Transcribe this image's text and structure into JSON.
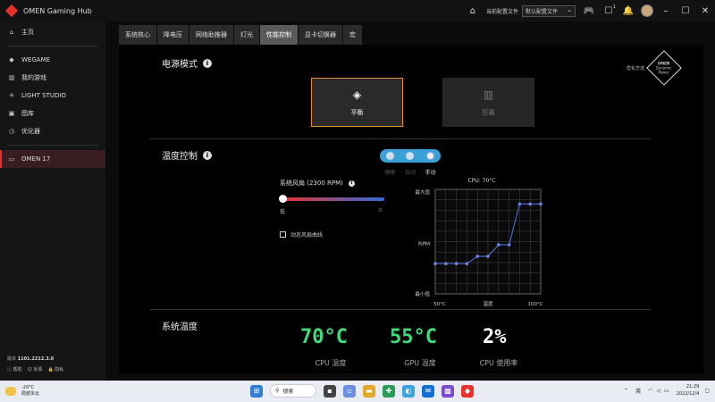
{
  "app": {
    "title": "OMEN Gaming Hub"
  },
  "titlebar": {
    "profile_label": "当前配置文件",
    "profile_value": "默认配置文件",
    "icons": [
      "home-icon",
      "gamepad-icon",
      "notification-icon",
      "bell-icon",
      "avatar"
    ],
    "notification_badge": "1"
  },
  "sidebar": {
    "items": [
      {
        "label": "主页",
        "icon": "home-icon"
      },
      {
        "label": "WEGAME",
        "icon": "wegame-icon"
      },
      {
        "label": "我的游戏",
        "icon": "library-icon"
      },
      {
        "label": "LIGHT STUDIO",
        "icon": "light-icon"
      },
      {
        "label": "图库",
        "icon": "gallery-icon"
      },
      {
        "label": "优化器",
        "icon": "optimizer-icon"
      }
    ],
    "device": {
      "label": "OMEN 17",
      "icon": "laptop-icon"
    },
    "version_label": "版本",
    "version": "1101.2212.3.0",
    "links": [
      "帮助",
      "反馈",
      "隐私"
    ]
  },
  "tabs": [
    {
      "label": "系统核心",
      "active": false
    },
    {
      "label": "降电压",
      "active": false
    },
    {
      "label": "网络助推器",
      "active": false
    },
    {
      "label": "灯光",
      "active": false
    },
    {
      "label": "性能控制",
      "active": true
    },
    {
      "label": "显卡切换器",
      "active": false
    },
    {
      "label": "宏",
      "active": false
    }
  ],
  "power": {
    "title": "电源模式",
    "modes": [
      {
        "label": "平衡",
        "selected": true
      },
      {
        "label": "狂暴",
        "selected": false
      }
    ],
    "badge_caption": "优化方法",
    "badge_lines": [
      "OMEN",
      "Dynamic",
      "Power"
    ]
  },
  "thermal": {
    "title": "温度控制",
    "modes": [
      "睡眠",
      "自动",
      "手动"
    ],
    "selected_mode": "手动",
    "fan_label": "系统风扇 (2300 RPM)",
    "slider_low": "低",
    "slider_high": "高",
    "slider_value": 0,
    "checkbox_label": "动态风扇曲线",
    "checkbox_checked": false
  },
  "chart_data": {
    "type": "line",
    "title": "CPU: 70°C",
    "xlabel": "温度",
    "ylabel": "RPM",
    "x_tick_labels": [
      "50°C",
      "100°C"
    ],
    "y_tick_labels": [
      "最大值",
      "最小值"
    ],
    "xlim": [
      50,
      100
    ],
    "ylim": [
      0,
      100
    ],
    "series": [
      {
        "x": [
          50,
          55,
          60,
          65,
          70,
          75,
          80,
          85,
          90,
          95,
          100
        ],
        "y": [
          29,
          29,
          29,
          29,
          36,
          36,
          47,
          47,
          86,
          86,
          86
        ]
      }
    ],
    "color": "#4d66c4",
    "grid": true
  },
  "system_temp": {
    "title": "系统温度",
    "readings": [
      {
        "value": "70°C",
        "label": "CPU 温度",
        "color": "#3ddc7a"
      },
      {
        "value": "55°C",
        "label": "GPU 温度",
        "color": "#3ddc7a"
      },
      {
        "value": "2%",
        "label": "CPU 使用率",
        "color": "#ffffff"
      }
    ]
  },
  "taskbar": {
    "weather_temp": "-20°C",
    "weather_desc": "局部多云",
    "search_label": "搜索",
    "ime": "英",
    "time": "21:29",
    "date": "2022/12/4"
  }
}
